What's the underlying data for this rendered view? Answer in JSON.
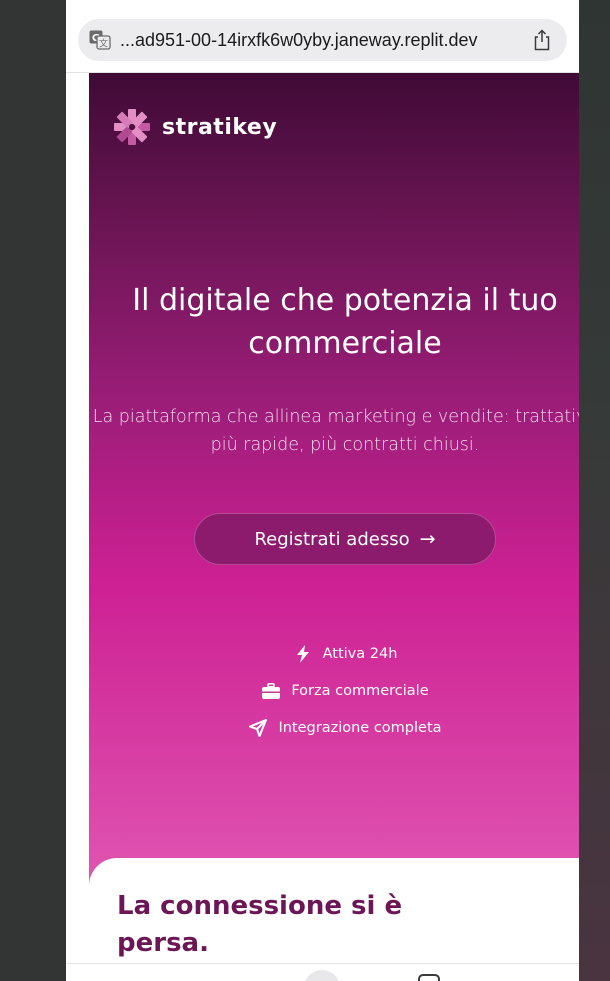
{
  "browser": {
    "url": "...ad951-00-14irxfk6w0yby.janeway.replit.dev",
    "icons": [
      "translate-icon",
      "share-icon"
    ]
  },
  "brand": {
    "name": "stratikey",
    "logo_icon": "asterisk-logo-icon",
    "colors": {
      "dark": "#3f0a36",
      "primary": "#cd2093",
      "light": "#e056b2",
      "title": "#6d1656"
    }
  },
  "hero": {
    "title": "Il digitale che potenzia il tuo commerciale",
    "subtitle": "La piattaforma che allinea marketing e vendite: trattative più rapide, più contratti chiusi.",
    "cta_label": "Registrati adesso",
    "cta_icon": "arrow-right-icon"
  },
  "features": [
    {
      "icon": "bolt-icon",
      "label": "Attiva 24h"
    },
    {
      "icon": "briefcase-icon",
      "label": "Forza commerciale"
    },
    {
      "icon": "send-icon",
      "label": "Integrazione completa"
    }
  ],
  "card": {
    "title": "La connessione si è persa."
  }
}
